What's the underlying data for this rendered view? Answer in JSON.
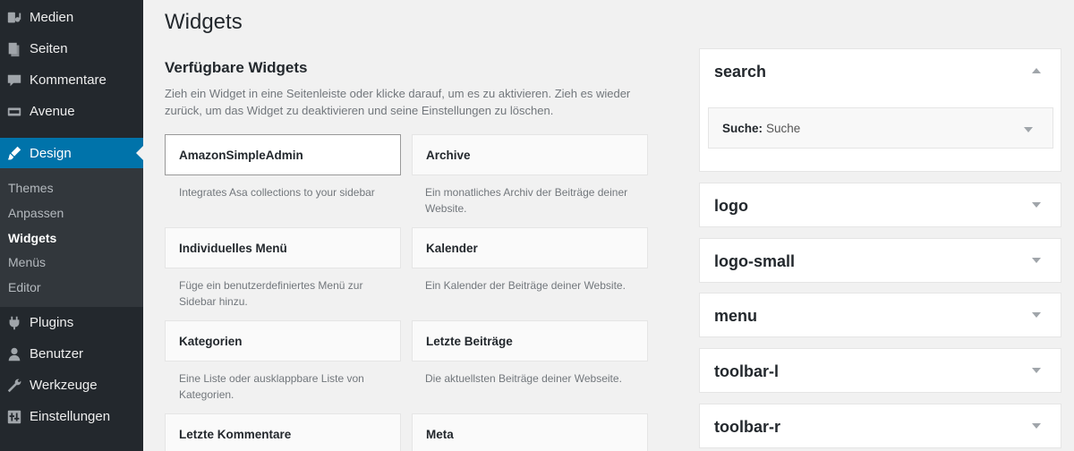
{
  "sidebar": {
    "items": [
      {
        "label": "Medien",
        "icon": "media-icon"
      },
      {
        "label": "Seiten",
        "icon": "pages-icon"
      },
      {
        "label": "Kommentare",
        "icon": "comments-icon"
      },
      {
        "label": "Avenue",
        "icon": "avenue-icon"
      },
      {
        "label": "Design",
        "icon": "design-brush-icon"
      },
      {
        "label": "Plugins",
        "icon": "plugins-icon"
      },
      {
        "label": "Benutzer",
        "icon": "users-icon"
      },
      {
        "label": "Werkzeuge",
        "icon": "tools-icon"
      },
      {
        "label": "Einstellungen",
        "icon": "settings-icon"
      }
    ],
    "submenu": [
      "Themes",
      "Anpassen",
      "Widgets",
      "Menüs",
      "Editor"
    ],
    "active_color": "#0073aa"
  },
  "main": {
    "title": "Widgets",
    "available_title": "Verfügbare Widgets",
    "available_desc": "Zieh ein Widget in eine Seitenleiste oder klicke darauf, um es zu aktivieren. Zieh es wieder zurück, um das Widget zu deaktivieren und seine Einstellungen zu löschen.",
    "widgets": [
      {
        "name": "AmazonSimpleAdmin",
        "desc": "Integrates Asa collections to your sidebar"
      },
      {
        "name": "Archive",
        "desc": "Ein monatliches Archiv der Beiträge deiner Website."
      },
      {
        "name": "Individuelles Menü",
        "desc": "Füge ein benutzerdefiniertes Menü zur Sidebar hinzu."
      },
      {
        "name": "Kalender",
        "desc": "Ein Kalender der Beiträge deiner Website."
      },
      {
        "name": "Kategorien",
        "desc": "Eine Liste oder ausklappbare Liste von Kategorien."
      },
      {
        "name": "Letzte Beiträge",
        "desc": "Die aktuellsten Beiträge deiner Webseite."
      },
      {
        "name": "Letzte Kommentare",
        "desc": ""
      },
      {
        "name": "Meta",
        "desc": ""
      }
    ]
  },
  "areas": {
    "search": {
      "title": "search",
      "widget_label": "Suche:",
      "widget_value": "Suche"
    },
    "others": [
      "logo",
      "logo-small",
      "menu",
      "toolbar-l",
      "toolbar-r"
    ]
  }
}
